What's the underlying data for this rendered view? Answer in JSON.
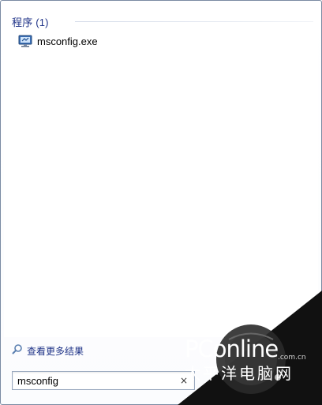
{
  "results": {
    "group_header": "程序 (1)",
    "items": [
      {
        "label": "msconfig.exe",
        "icon": "system-config-icon"
      }
    ]
  },
  "see_more": {
    "label": "查看更多结果",
    "icon": "search-icon"
  },
  "search": {
    "value": "msconfig",
    "clear_label": "×"
  },
  "watermark": {
    "brand": "PConline",
    "domain": ".com.cn",
    "cn_name": "太平洋电脑网"
  },
  "colors": {
    "group_header": "#1e3287",
    "link": "#1e3287",
    "panel_border": "#7a8ba3",
    "watermark_bg": "#111111"
  }
}
